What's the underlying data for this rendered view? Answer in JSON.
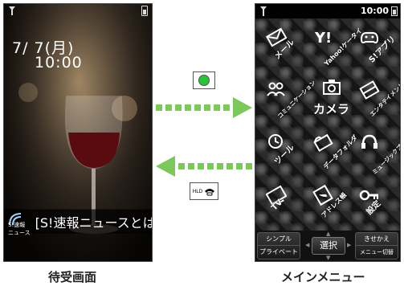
{
  "standby": {
    "date": "7/ 7(月)",
    "time": "10:00",
    "news_logo": "S!速報\nニュース",
    "news_ticker": "[S!速報ニュースとは"
  },
  "keys": {
    "center_key_icon": "green-circle-key",
    "hld_label": "HLD"
  },
  "menu": {
    "clock": "10:00",
    "items": [
      {
        "label": "メール",
        "icon": "mail-icon"
      },
      {
        "label": "Yahoo!ケータイ",
        "icon": "yahoo-icon"
      },
      {
        "label": "S!アプリ",
        "icon": "app-icon"
      },
      {
        "label": "コミュニケーション",
        "icon": "communication-icon"
      },
      {
        "label": "カメラ",
        "icon": "camera-icon"
      },
      {
        "label": "エンタテイメント",
        "icon": "entertainment-icon"
      },
      {
        "label": "ツール",
        "icon": "tool-icon"
      },
      {
        "label": "データフォルダ",
        "icon": "data-folder-icon"
      },
      {
        "label": "ミュージックプレイヤー",
        "icon": "music-player-icon"
      },
      {
        "label": "TV",
        "icon": "tv-icon"
      },
      {
        "label": "アドレス帳",
        "icon": "address-book-icon"
      },
      {
        "label": "設定",
        "icon": "settings-icon"
      }
    ],
    "softkeys": {
      "left_top": "シンプル",
      "left_bottom": "プライベート",
      "center": "選択",
      "right_top": "きせかえ",
      "right_bottom": "メニュー切替"
    }
  },
  "captions": {
    "standby": "待受画面",
    "main_menu": "メインメニュー"
  },
  "colors": {
    "arrow_green": "#7dc85a",
    "center_key": "#27c43c"
  }
}
